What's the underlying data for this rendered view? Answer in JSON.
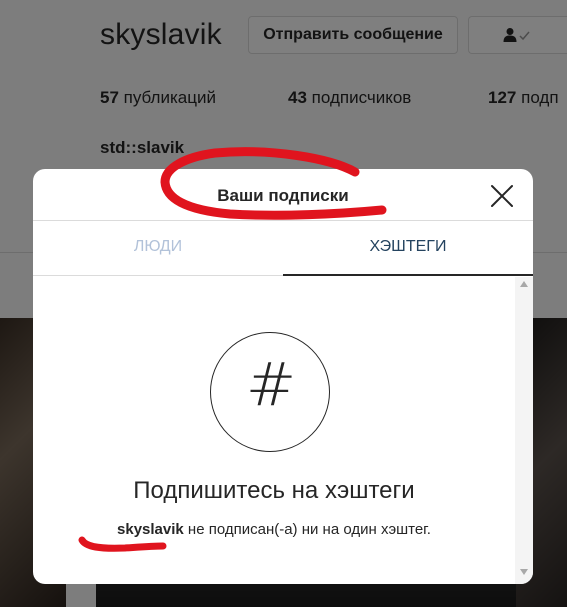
{
  "profile": {
    "username": "skyslavik",
    "message_button": "Отправить сообщение",
    "follow_icon": "user-check-icon",
    "stats": {
      "posts_count": "57",
      "posts_label": "публикаций",
      "followers_count": "43",
      "followers_label": "подписчиков",
      "following_count": "127",
      "following_label": "подп"
    },
    "full_name": "std::slavik"
  },
  "modal": {
    "title": "Ваши подписки",
    "close_icon": "close-icon",
    "tabs": [
      {
        "label": "ЛЮДИ",
        "active": false
      },
      {
        "label": "ХЭШТЕГИ",
        "active": true
      }
    ],
    "empty_state": {
      "icon": "hashtag-icon",
      "title": "Подпишитесь на хэштеги",
      "desc_user": "skyslavik",
      "desc_text": " не подписан(-а) ни на один хэштег."
    }
  },
  "colors": {
    "annotation": "#e0141e",
    "active_tab_text": "#24435f",
    "inactive_tab_text": "#b2c2d9"
  }
}
